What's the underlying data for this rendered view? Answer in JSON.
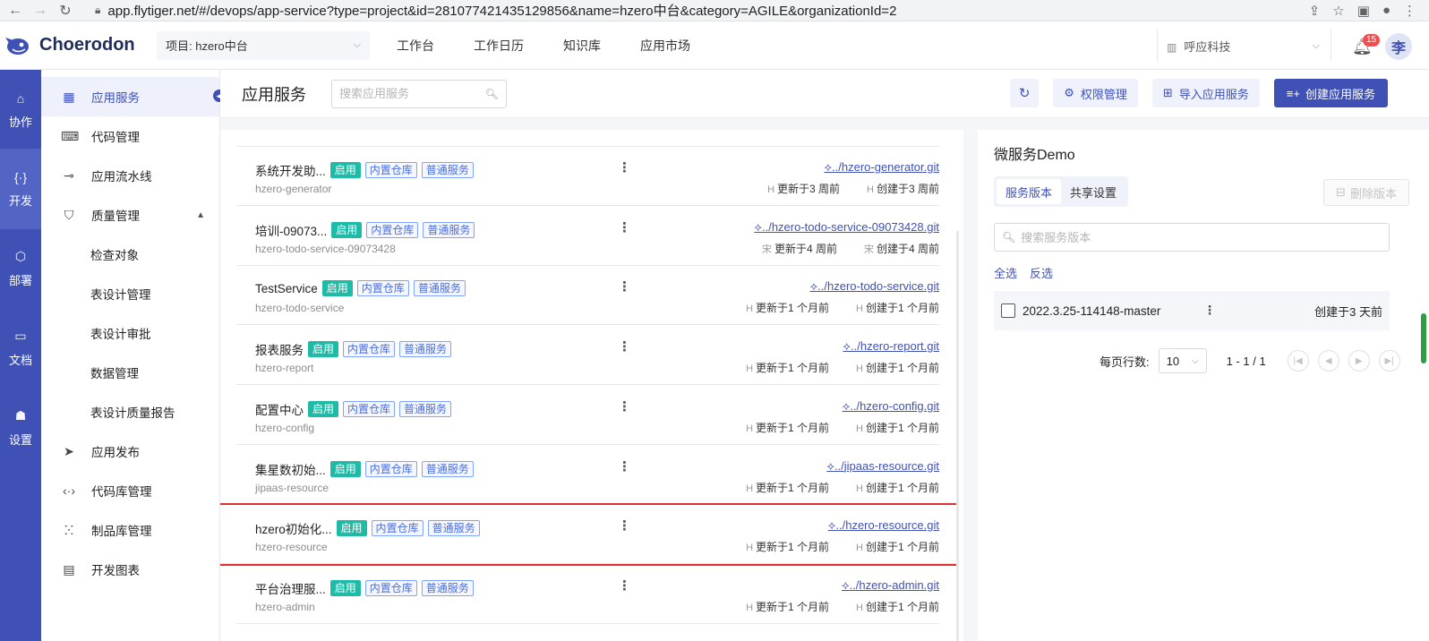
{
  "browser": {
    "url": "app.flytiger.net/#/devops/app-service?type=project&id=281077421435129856&name=hzero中台&category=AGILE&organizationId=2"
  },
  "header": {
    "app_name": "Choerodon",
    "project_label": "项目: hzero中台",
    "menu": [
      "工作台",
      "工作日历",
      "知识库",
      "应用市场"
    ],
    "org_name": "呼应科技",
    "notification_count": "15",
    "avatar_text": "李"
  },
  "rail": [
    {
      "label": "协作",
      "icon": "collab-icon"
    },
    {
      "label": "开发",
      "icon": "code-brackets-icon",
      "active": true
    },
    {
      "label": "部署",
      "icon": "deploy-icon"
    },
    {
      "label": "文档",
      "icon": "inbox-icon"
    },
    {
      "label": "设置",
      "icon": "settings-icon"
    }
  ],
  "sidebar": {
    "items": [
      {
        "label": "应用服务",
        "icon": "grid-icon",
        "active": true
      },
      {
        "label": "代码管理",
        "icon": "code-window-icon"
      },
      {
        "label": "应用流水线",
        "icon": "pipeline-icon"
      },
      {
        "label": "质量管理",
        "icon": "shield-icon",
        "expanded": true
      },
      {
        "label": "应用发布",
        "icon": "send-icon"
      },
      {
        "label": "代码库管理",
        "icon": "code-repo-icon"
      },
      {
        "label": "制品库管理",
        "icon": "artifact-icon"
      },
      {
        "label": "开发图表",
        "icon": "chart-icon"
      }
    ],
    "sub_items": [
      "检查对象",
      "表设计管理",
      "表设计审批",
      "数据管理",
      "表设计质量报告"
    ]
  },
  "page": {
    "title": "应用服务",
    "search_placeholder": "搜索应用服务",
    "actions": {
      "permissions": "权限管理",
      "import": "导入应用服务",
      "create": "创建应用服务"
    }
  },
  "services": [
    {
      "name": "系统开发助...",
      "status": "启用",
      "repo": "内置仓库",
      "type": "普通服务",
      "code": "hzero-generator",
      "git": "../hzero-generator.git",
      "updated_avatar": "H",
      "updated": "更新于3 周前",
      "created_avatar": "H",
      "created": "创建于3 周前"
    },
    {
      "name": "培训-09073...",
      "status": "启用",
      "repo": "内置仓库",
      "type": "普通服务",
      "code": "hzero-todo-service-09073428",
      "git": "../hzero-todo-service-09073428.git",
      "updated_avatar": "宋",
      "updated": "更新于4 周前",
      "created_avatar": "宋",
      "created": "创建于4 周前"
    },
    {
      "name": "TestService",
      "status": "启用",
      "repo": "内置仓库",
      "type": "普通服务",
      "code": "hzero-todo-service",
      "git": "../hzero-todo-service.git",
      "updated_avatar": "H",
      "updated": "更新于1 个月前",
      "created_avatar": "H",
      "created": "创建于1 个月前"
    },
    {
      "name": "报表服务",
      "status": "启用",
      "repo": "内置仓库",
      "type": "普通服务",
      "code": "hzero-report",
      "git": "../hzero-report.git",
      "updated_avatar": "H",
      "updated": "更新于1 个月前",
      "created_avatar": "H",
      "created": "创建于1 个月前"
    },
    {
      "name": "配置中心",
      "status": "启用",
      "repo": "内置仓库",
      "type": "普通服务",
      "code": "hzero-config",
      "git": "../hzero-config.git",
      "updated_avatar": "H",
      "updated": "更新于1 个月前",
      "created_avatar": "H",
      "created": "创建于1 个月前"
    },
    {
      "name": "集星数初始...",
      "status": "启用",
      "repo": "内置仓库",
      "type": "普通服务",
      "code": "jipaas-resource",
      "git": "../jipaas-resource.git",
      "updated_avatar": "H",
      "updated": "更新于1 个月前",
      "created_avatar": "H",
      "created": "创建于1 个月前"
    },
    {
      "name": "hzero初始化...",
      "status": "启用",
      "repo": "内置仓库",
      "type": "普通服务",
      "code": "hzero-resource",
      "git": "../hzero-resource.git",
      "updated_avatar": "H",
      "updated": "更新于1 个月前",
      "created_avatar": "H",
      "created": "创建于1 个月前",
      "highlighted": true
    },
    {
      "name": "平台治理服...",
      "status": "启用",
      "repo": "内置仓库",
      "type": "普通服务",
      "code": "hzero-admin",
      "git": "../hzero-admin.git",
      "updated_avatar": "H",
      "updated": "更新于1 个月前",
      "created_avatar": "H",
      "created": "创建于1 个月前"
    }
  ],
  "detail": {
    "title": "微服务Demo",
    "tabs": [
      "服务版本",
      "共享设置"
    ],
    "delete_label": "删除版本",
    "search_placeholder": "搜索服务版本",
    "select_all": "全选",
    "invert": "反选",
    "versions": [
      {
        "name": "2022.3.25-114148-master",
        "created": "创建于3 天前"
      }
    ],
    "pager": {
      "rows_label": "每页行数:",
      "page_size": "10",
      "range": "1 - 1 / 1"
    }
  }
}
